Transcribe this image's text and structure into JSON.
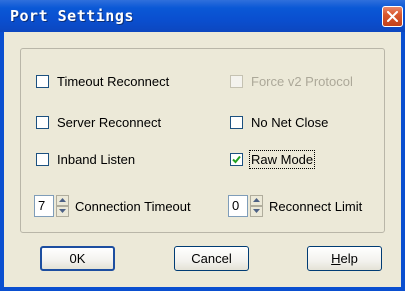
{
  "dialog": {
    "title": "Port Settings",
    "options": {
      "timeout_reconnect": {
        "label": "Timeout Reconnect",
        "checked": false,
        "enabled": true
      },
      "force_v2_protocol": {
        "label": "Force v2 Protocol",
        "checked": false,
        "enabled": false
      },
      "server_reconnect": {
        "label": "Server Reconnect",
        "checked": false,
        "enabled": true
      },
      "no_net_close": {
        "label": "No Net Close",
        "checked": false,
        "enabled": true
      },
      "inband_listen": {
        "label": "Inband Listen",
        "checked": false,
        "enabled": true
      },
      "raw_mode": {
        "label": "Raw Mode",
        "checked": true,
        "enabled": true
      }
    },
    "connection_timeout": {
      "value": "7",
      "label": "Connection Timeout"
    },
    "reconnect_limit": {
      "value": "0",
      "label": "Reconnect Limit"
    },
    "buttons": {
      "ok": "0K",
      "cancel": "Cancel",
      "help_mnemonic": "H",
      "help_rest": "elp"
    }
  }
}
